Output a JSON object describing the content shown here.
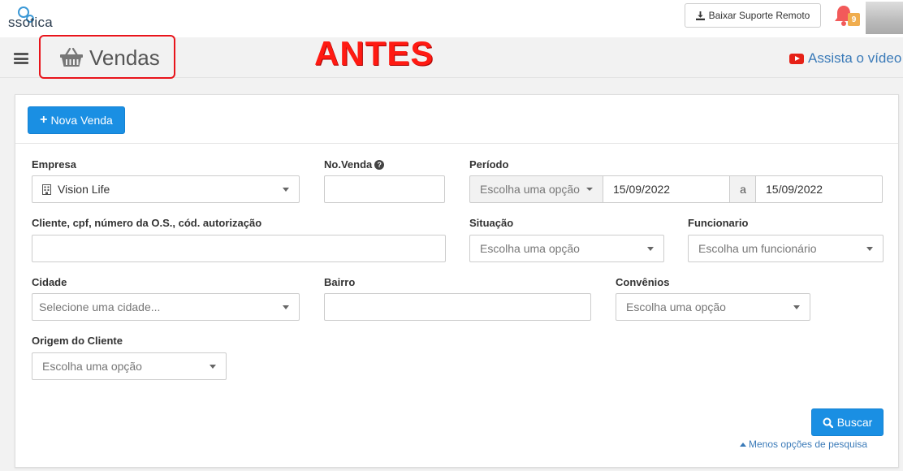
{
  "header": {
    "logo_text": "ssotica",
    "support_button": "Baixar Suporte Remoto",
    "notification_count": "9"
  },
  "pagebar": {
    "title": "Vendas",
    "annotation": "ANTES",
    "video_link": "Assista o vídeo"
  },
  "toolbar": {
    "new_sale_button": "Nova Venda"
  },
  "form": {
    "empresa": {
      "label": "Empresa",
      "value": "Vision Life"
    },
    "no_venda": {
      "label": "No.Venda",
      "value": ""
    },
    "periodo": {
      "label": "Período",
      "select_placeholder": "Escolha uma opção",
      "date_from": "15/09/2022",
      "separator": "a",
      "date_to": "15/09/2022"
    },
    "cliente": {
      "label": "Cliente, cpf, número da O.S., cód. autorização",
      "value": ""
    },
    "situacao": {
      "label": "Situação",
      "placeholder": "Escolha uma opção"
    },
    "funcionario": {
      "label": "Funcionario",
      "placeholder": "Escolha um funcionário"
    },
    "cidade": {
      "label": "Cidade",
      "placeholder": "Selecione uma cidade..."
    },
    "bairro": {
      "label": "Bairro",
      "value": ""
    },
    "convenios": {
      "label": "Convênios",
      "placeholder": "Escolha uma opção"
    },
    "origem": {
      "label": "Origem do Cliente",
      "placeholder": "Escolha uma opção"
    }
  },
  "actions": {
    "search_button": "Buscar",
    "less_options_link": "Menos opções de pesquisa"
  },
  "colors": {
    "primary": "#1a8fe3",
    "annotation_red": "#e8141b",
    "link": "#3a7ab8",
    "badge": "#f0ad4e"
  }
}
